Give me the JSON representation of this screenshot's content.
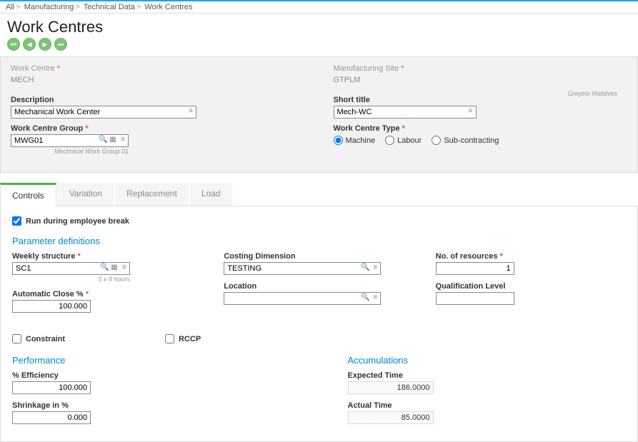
{
  "breadcrumb": [
    "All",
    "Manufacturing",
    "Technical Data",
    "Work Centres"
  ],
  "page_title": "Work Centres",
  "header": {
    "work_centre_label": "Work Centre",
    "work_centre_value": "MECH",
    "description_label": "Description",
    "description_value": "Mechanical Work Center",
    "group_label": "Work Centre Group",
    "group_value": "MWG01",
    "group_helper": "Mechnical Work Group  01",
    "site_label": "Manufacturing Site",
    "site_value": "GTPLM",
    "site_helper": "Greytrix   Maldives",
    "short_title_label": "Short title",
    "short_title_value": "Mech-WC",
    "type_label": "Work Centre Type",
    "type_options": {
      "machine": "Machine",
      "labour": "Labour",
      "sub": "Sub-contracting"
    }
  },
  "tabs": {
    "controls": "Controls",
    "variation": "Variation",
    "replacement": "Replacement",
    "load": "Load"
  },
  "controls": {
    "run_break": "Run during employee break",
    "param_title": "Parameter definitions",
    "weekly_label": "Weekly structure",
    "weekly_value": "SC1",
    "weekly_helper": "5 x 8 hours",
    "autoclose_label": "Automatic Close %",
    "autoclose_value": "100.000",
    "costdim_label": "Costing Dimension",
    "costdim_value": "TESTING",
    "location_label": "Location",
    "location_value": "",
    "nores_label": "No. of resources",
    "nores_value": "1",
    "qual_label": "Qualification Level",
    "qual_value": "",
    "constraint": "Constraint",
    "rccp": "RCCP",
    "perf_title": "Performance",
    "eff_label": "% Efficiency",
    "eff_value": "100.000",
    "shrink_label": "Shrinkage in %",
    "shrink_value": "0.000",
    "accum_title": "Accumulations",
    "expected_label": "Expected Time",
    "expected_value": "186.0000",
    "actual_label": "Actual Time",
    "actual_value": "85.0000"
  }
}
